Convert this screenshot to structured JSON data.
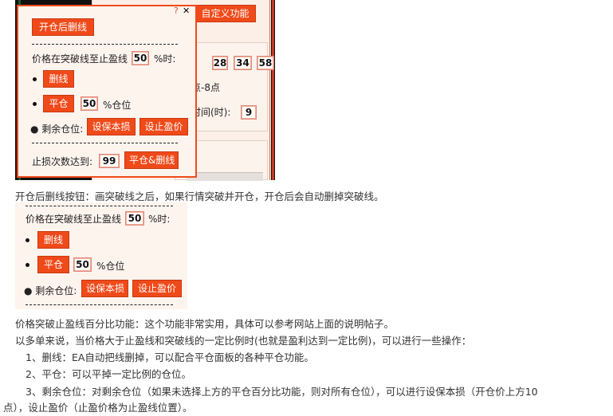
{
  "bg_window": {
    "custom_button": "自定义功能",
    "numbers": [
      "28",
      "34",
      "58"
    ],
    "text_points": "点-8点",
    "text_time": "时间(时):",
    "time_value": "9"
  },
  "popup": {
    "help_icon": "?",
    "close_icon": "✕",
    "open_delete_button": "开仓后删线",
    "breakout_label": "价格在突破线至止盈线",
    "breakout_value": "50",
    "percent_when": "%时:",
    "delete_button": "删线",
    "close_button": "平仓",
    "close_value": "50",
    "percent_position": "%仓位",
    "remaining_label": "● 剩余仓位:",
    "breakeven_button": "设保本损",
    "takeprofit_button": "设止盈价",
    "stoploss_label": "止损次数达到:",
    "stoploss_value": "99",
    "close_delete_button": "平仓&删线"
  },
  "text1": "开仓后删线按钮：画突破线之后，如果行情突破并开仓，开仓后会自动删掉突破线。",
  "panel2": {
    "breakout_label": "价格在突破线至止盈线",
    "breakout_value": "50",
    "percent_when": "%时:",
    "delete_button": "删线",
    "close_button": "平仓",
    "close_value": "50",
    "percent_position": "%仓位",
    "remaining_label": "● 剩余仓位:",
    "breakeven_button": "设保本损",
    "takeprofit_button": "设止盈价"
  },
  "paragraphs": [
    "价格突破止盈线百分比功能：这个功能非常实用，具体可以参考网站上面的说明帖子。",
    "以多单来说，当价格大于止盈线和突破线的一定比例时(也就是盈利达到一定比例)，可以进行一些操作：",
    "1、删线：EA自动把线删掉，可以配合平仓面板的各种平仓功能。",
    "2、平仓：可以平掉一定比例的仓位。",
    "3、剩余仓位：对剩余仓位（如果未选择上方的平仓百分比功能，则对所有仓位），可以进行设保本损（开仓价上方10",
    "点），设止盈价（止盈价格为止盈线位置）。"
  ],
  "colors": {
    "accent": "#f04a1a",
    "panel_bg": "#fdf4ee"
  }
}
